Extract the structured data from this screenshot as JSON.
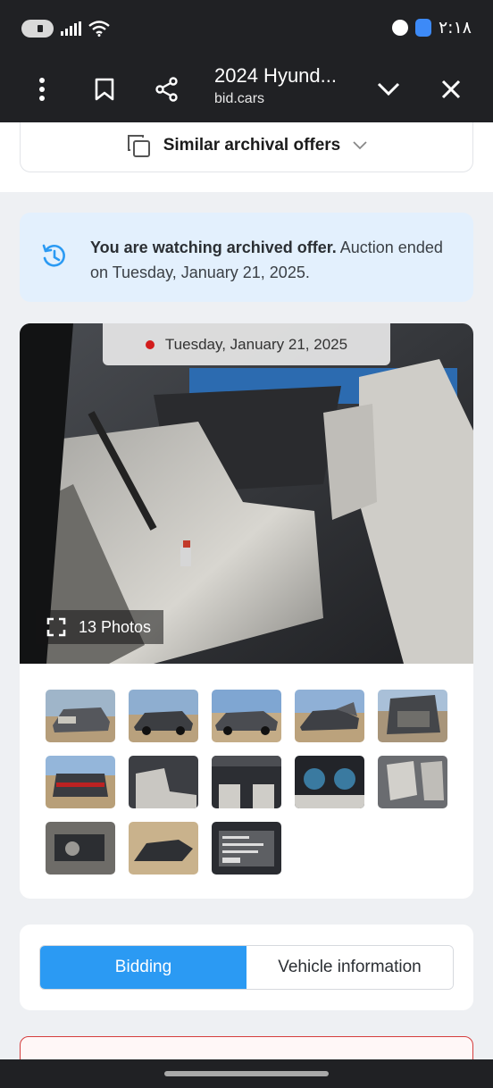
{
  "status_bar": {
    "time": "۲:۱۸"
  },
  "browser": {
    "page_title": "2024 Hyund...",
    "domain": "bid.cars"
  },
  "similar": {
    "label": "Similar archival offers"
  },
  "notice": {
    "bold": "You are watching archived offer.",
    "text": " Auction ended on Tuesday, January 21, 2025."
  },
  "gallery": {
    "date": "Tuesday, January 21, 2025",
    "photos_count": "13 Photos",
    "thumbnails": [
      "front-damage-left",
      "rear-left",
      "side-left",
      "front-damage-right",
      "engine-bay-damage",
      "rear-view",
      "rear-seat",
      "dashboard-front",
      "instrument-cluster",
      "rear-seat-right",
      "engine-close",
      "undercarriage-part",
      "vin-label"
    ]
  },
  "tabs": [
    {
      "label": "Bidding",
      "active": true
    },
    {
      "label": "Vehicle information",
      "active": false
    }
  ],
  "colors": {
    "accent": "#2b9af3",
    "notice_bg": "#e3f0fd",
    "alert_border": "#d53d3d",
    "topbar": "#202124"
  }
}
